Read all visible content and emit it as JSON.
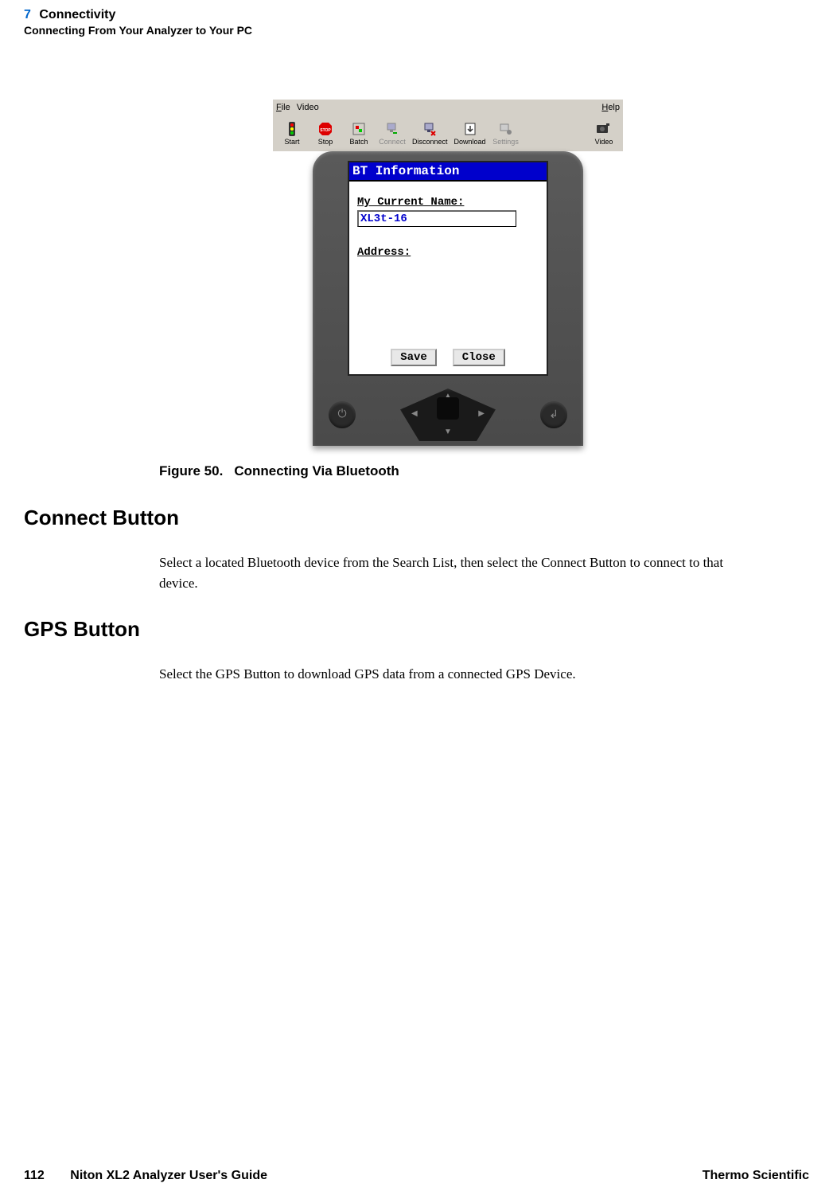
{
  "header": {
    "chapter_num": "7",
    "chapter_title": "Connectivity",
    "subtitle": "Connecting From Your Analyzer to Your PC"
  },
  "figure": {
    "menubar": {
      "file": "File",
      "video": "Video",
      "help": "Help"
    },
    "toolbar": {
      "start": "Start",
      "stop": "Stop",
      "batch": "Batch",
      "connect": "Connect",
      "disconnect": "Disconnect",
      "download": "Download",
      "settings": "Settings",
      "video_btn": "Video"
    },
    "screen": {
      "title": "BT Information",
      "name_label": "My Current Name:",
      "name_value": "XL3t-16",
      "address_label": "Address:",
      "save": "Save",
      "close": "Close"
    },
    "caption_prefix": "Figure 50.",
    "caption_text": "Connecting Via Bluetooth"
  },
  "sections": {
    "connect": {
      "heading": "Connect Button",
      "body": "Select a located Bluetooth device from the Search List, then select the Connect Button to connect to that device."
    },
    "gps": {
      "heading": "GPS Button",
      "body": "Select the GPS Button to download GPS data from a connected GPS Device."
    }
  },
  "footer": {
    "page": "112",
    "guide": "Niton XL2 Analyzer User's Guide",
    "brand": "Thermo Scientific"
  }
}
